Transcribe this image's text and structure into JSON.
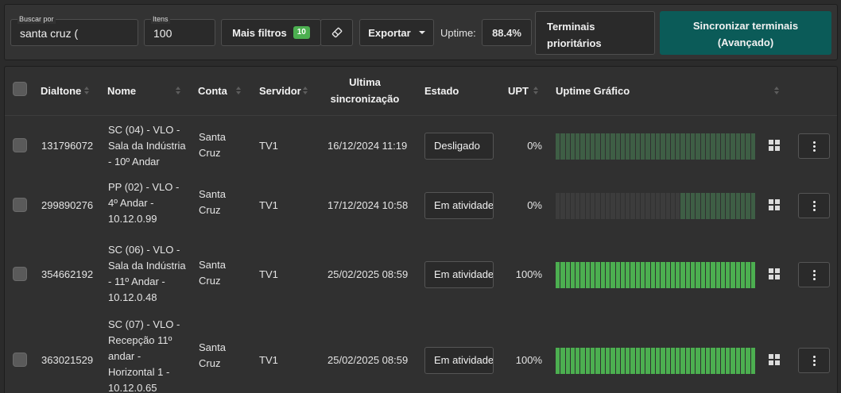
{
  "filters": {
    "search_label": "Buscar por",
    "search_value": "santa cruz (",
    "items_label": "Itens",
    "items_value": "100",
    "more_filters_label": "Mais filtros",
    "more_filters_count": "10",
    "clear_icon": "eraser-icon",
    "export_label": "Exportar",
    "uptime_label": "Uptime:",
    "uptime_value": "88.4%",
    "priority_line1": "Terminais",
    "priority_line2": "prioritários",
    "sync_line1": "Sincronizar terminais",
    "sync_line2": "(Avançado)"
  },
  "table": {
    "headers": {
      "dialtone": "Dialtone",
      "name": "Nome",
      "account": "Conta",
      "server": "Servidor",
      "last_sync_line1": "Ultima",
      "last_sync_line2": "sincronização",
      "state": "Estado",
      "upt": "UPT",
      "uptime_chart": "Uptime Gráfico"
    },
    "rows": [
      {
        "dialtone": "131796072",
        "name_lines": [
          "SC (04) - VLO -",
          "Sala da Indústria",
          "- 10º Andar"
        ],
        "account_lines": [
          "Santa",
          "Cruz"
        ],
        "server": "TV1",
        "last_sync": "16/12/2024 11:19",
        "state": "Desligado",
        "upt": "0%",
        "uptime_fraction": 0,
        "os_icon": "windows-icon"
      },
      {
        "dialtone": "299890276",
        "name_lines": [
          "PP (02) - VLO -",
          "4º Andar -",
          "10.12.0.99"
        ],
        "account_lines": [
          "Santa",
          "Cruz"
        ],
        "server": "TV1",
        "last_sync": "17/12/2024 10:58",
        "state": "Em atividade",
        "upt": "0%",
        "uptime_fraction": 0,
        "os_icon": "windows-icon"
      },
      {
        "dialtone": "354662192",
        "name_lines": [
          "SC (06) - VLO -",
          "Sala da Indústria",
          "- 11º Andar -",
          "10.12.0.48"
        ],
        "account_lines": [
          "Santa",
          "Cruz"
        ],
        "server": "TV1",
        "last_sync": "25/02/2025 08:59",
        "state": "Em atividade",
        "upt": "100%",
        "uptime_fraction": 1,
        "os_icon": "windows-icon"
      },
      {
        "dialtone": "363021529",
        "name_lines": [
          "SC (07) - VLO -",
          "Recepção 11º",
          "andar -",
          "Horizontal 1 -",
          "10.12.0.65"
        ],
        "account_lines": [
          "Santa",
          "Cruz"
        ],
        "server": "TV1",
        "last_sync": "25/02/2025 08:59",
        "state": "Em atividade",
        "upt": "100%",
        "uptime_fraction": 1,
        "os_icon": "windows-icon"
      }
    ]
  },
  "colors": {
    "sync_button": "#0b5b58",
    "badge": "#4caf50",
    "uptime_up": "#4caf50",
    "uptime_down_dim": "#3e5e45",
    "uptime_none": "#3c3c3c"
  }
}
